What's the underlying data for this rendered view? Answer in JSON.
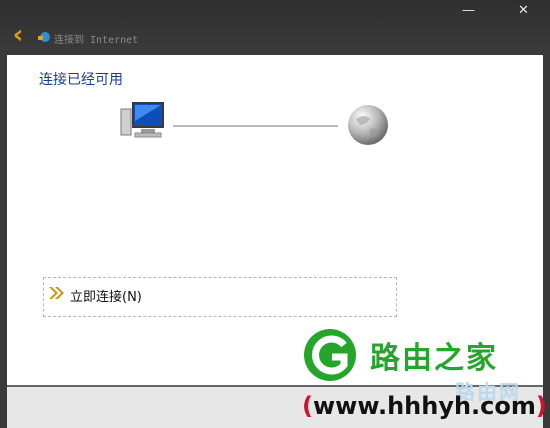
{
  "window": {
    "title": "连接到 Internet",
    "minimize_glyph": "—",
    "close_glyph": "✕"
  },
  "back_glyph": "‹",
  "icons": {
    "back": "back-arrow-icon",
    "app": "network-app-icon",
    "computer": "computer-icon",
    "internet": "globe-icon",
    "connect": "double-chevron-icon"
  },
  "main": {
    "status_text": "连接已经可用",
    "connect_option_label": "立即连接(N)"
  },
  "watermark": {
    "brand": "路由之家",
    "ghost_text": "路由网",
    "url_open": "(",
    "url": "www.hhhyh.com",
    "url_close": ")"
  },
  "colors": {
    "accent_back": "#d9a200",
    "status_text": "#1c3d8f",
    "watermark_green": "#26a52b",
    "watermark_paren": "#d0122f"
  }
}
